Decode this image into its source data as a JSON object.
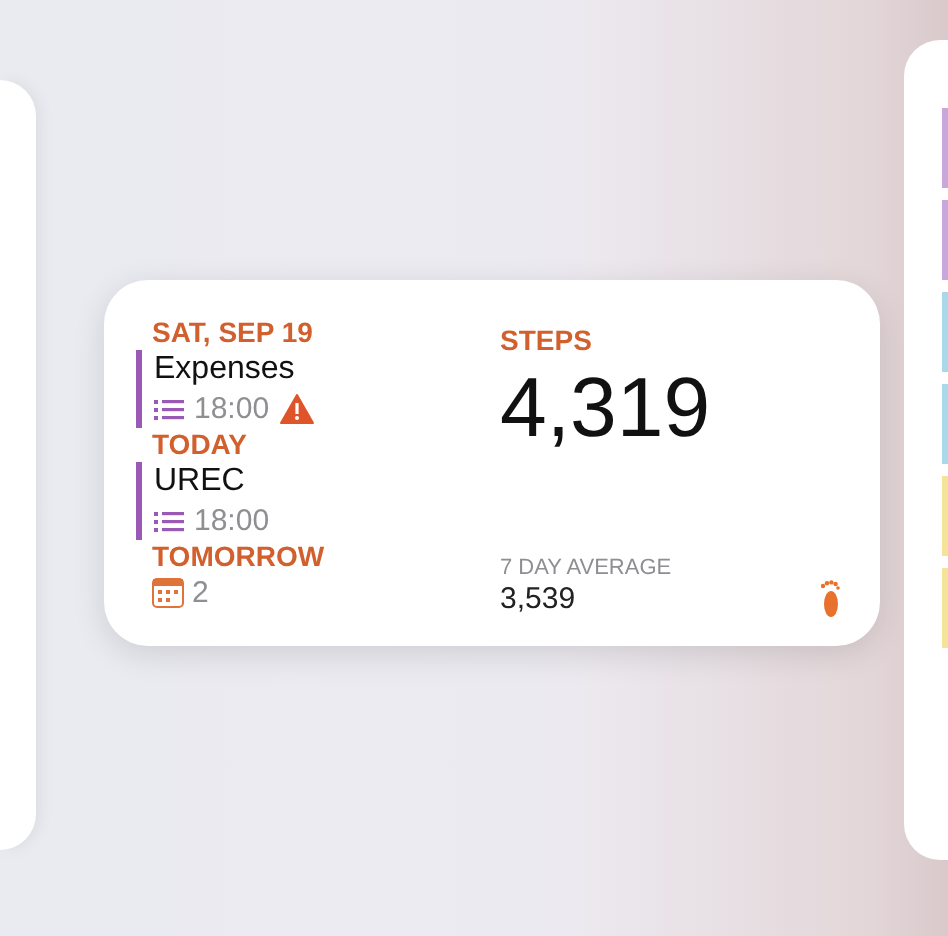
{
  "widget": {
    "sections": [
      {
        "heading": "SAT, SEP 19",
        "items": [
          {
            "kind": "event",
            "title": "Expenses",
            "time": "18:00",
            "alert": true,
            "color": "#9b59b6"
          }
        ]
      },
      {
        "heading": "TODAY",
        "items": [
          {
            "kind": "event",
            "title": "UREC",
            "time": "18:00",
            "alert": false,
            "color": "#9b59b6"
          }
        ]
      },
      {
        "heading": "TOMORROW",
        "items": [
          {
            "kind": "count",
            "count": "2"
          }
        ]
      }
    ],
    "steps": {
      "label": "STEPS",
      "value": "4,319",
      "average_label": "7 DAY AVERAGE",
      "average": "3,539"
    }
  },
  "right_card": {
    "entries": [
      {
        "color": "#c9a6dc"
      },
      {
        "color": "#c9a6dc"
      },
      {
        "color": "#a9d8ea"
      },
      {
        "color": "#a9d8ea"
      },
      {
        "color": "#f5e39a"
      },
      {
        "color": "#f5e39a"
      }
    ]
  }
}
